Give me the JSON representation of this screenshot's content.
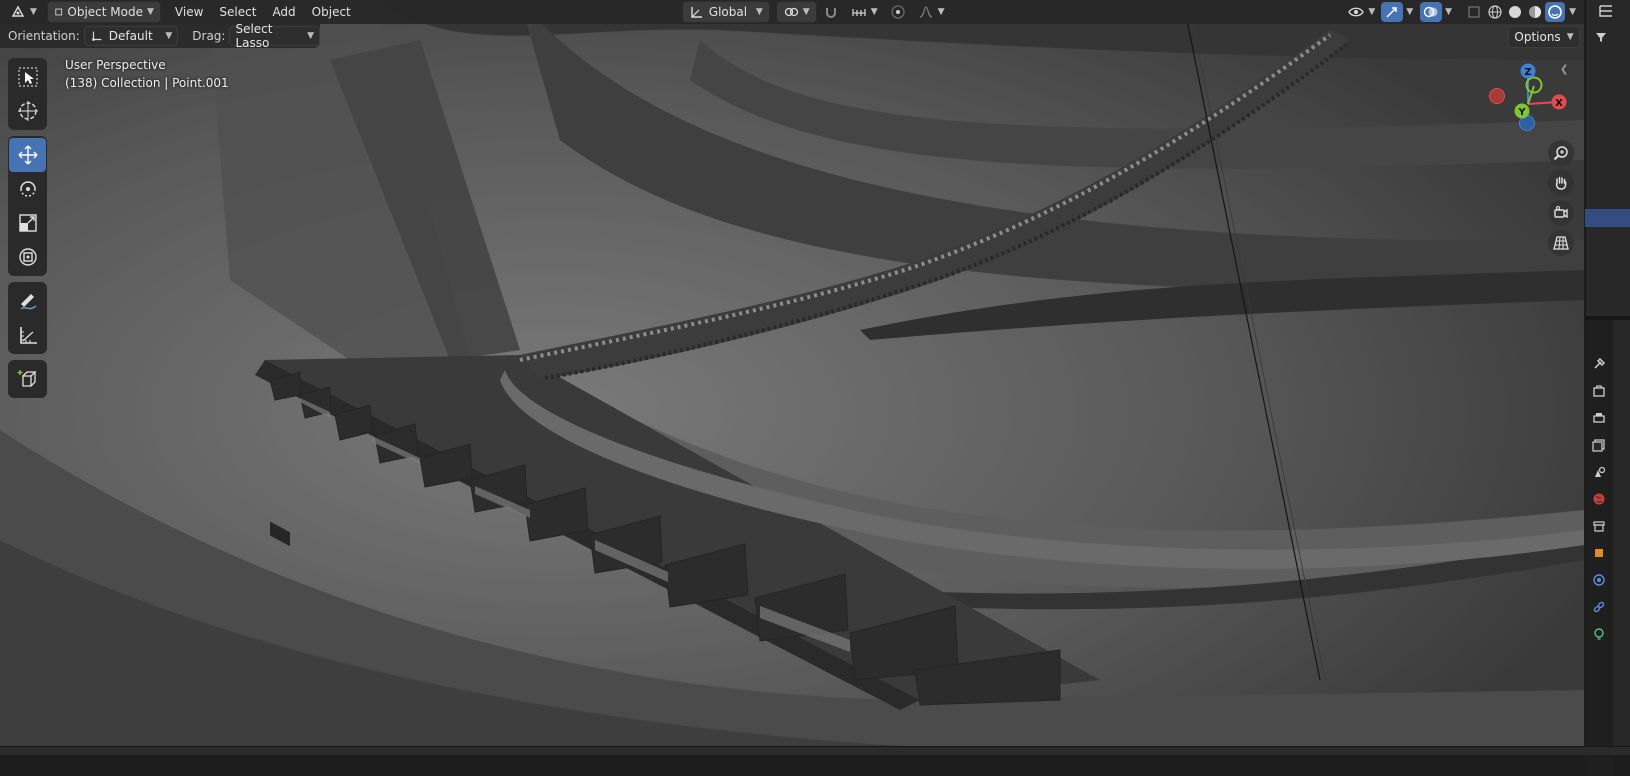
{
  "header": {
    "mode_label": "Object Mode",
    "menus": [
      "View",
      "Select",
      "Add",
      "Object"
    ],
    "transform_orientation": "Global"
  },
  "tool_settings": {
    "orientation_label": "Orientation:",
    "orientation_value": "Default",
    "drag_label": "Drag:",
    "drag_value": "Select Lasso",
    "options_label": "Options"
  },
  "viewport": {
    "perspective": "User Perspective",
    "context": "(138) Collection | Point.001"
  },
  "gizmo": {
    "x_label": "X",
    "y_label": "Y",
    "z_label": "Z"
  },
  "colors": {
    "accent": "#4772b3",
    "axis_x": "#e34c4c",
    "axis_y": "#7fc72e",
    "axis_z": "#3d82d9"
  },
  "toolbar_tools": [
    "select-box",
    "cursor",
    "move",
    "rotate",
    "scale",
    "transform",
    "annotate",
    "measure",
    "add-cube"
  ],
  "active_tool": "move"
}
